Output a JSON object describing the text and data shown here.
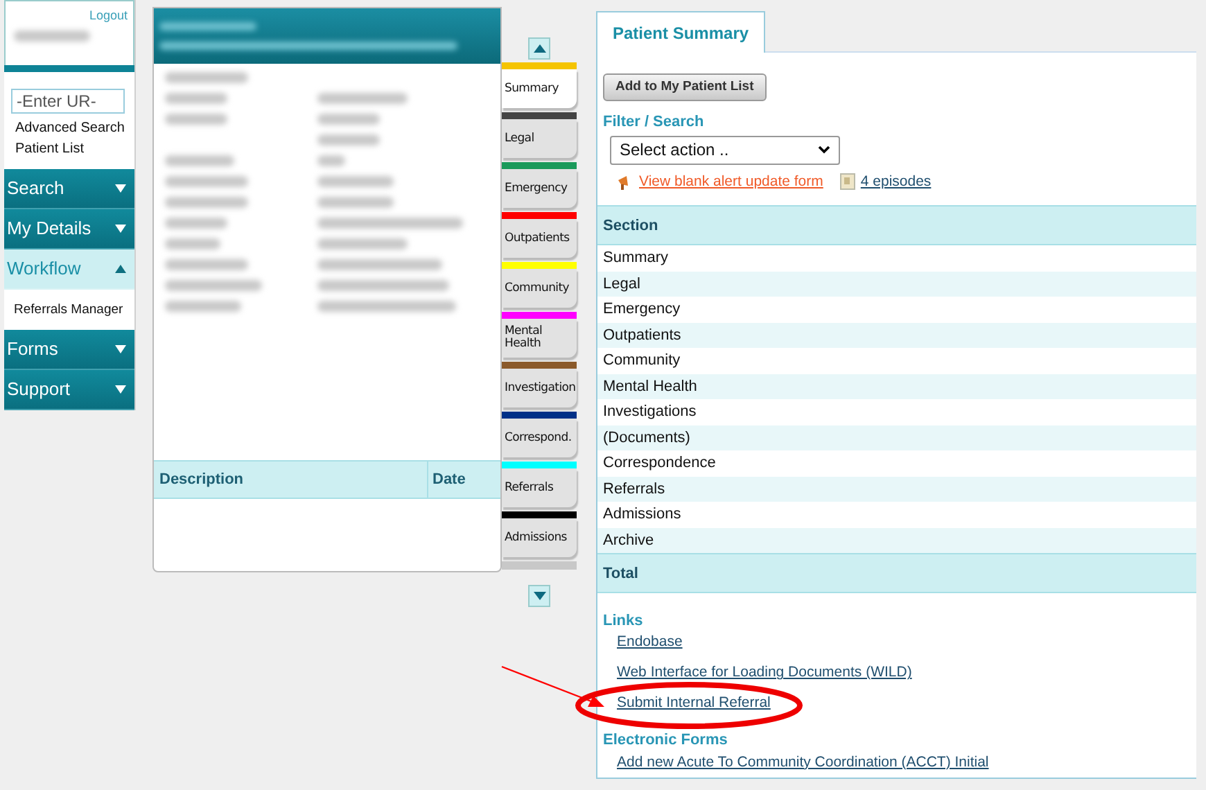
{
  "header": {
    "logout": "Logout"
  },
  "ur_search": {
    "placeholder": "-Enter UR-"
  },
  "quick_links": [
    "Advanced Search",
    "Patient List"
  ],
  "menu": [
    {
      "label": "Search",
      "expanded": false
    },
    {
      "label": "My Details",
      "expanded": false
    },
    {
      "label": "Workflow",
      "expanded": true,
      "children": [
        "Referrals Manager"
      ]
    },
    {
      "label": "Forms",
      "expanded": false
    },
    {
      "label": "Support",
      "expanded": false
    }
  ],
  "details_table": {
    "columns": [
      "Description",
      "Date"
    ]
  },
  "side_tabs": [
    {
      "label": "Summary",
      "color": "#f5c400",
      "selected": true
    },
    {
      "label": "Legal",
      "color": "#444444",
      "selected": false
    },
    {
      "label": "Emergency",
      "color": "#1a9a5a",
      "selected": false
    },
    {
      "label": "Outpatients",
      "color": "#ff0000",
      "selected": false
    },
    {
      "label": "Community",
      "color": "#ffff00",
      "selected": false
    },
    {
      "label": "Mental Health",
      "color": "#ff00ff",
      "selected": false
    },
    {
      "label": "Investigation",
      "color": "#8b5a2b",
      "selected": false
    },
    {
      "label": "Correspond.",
      "color": "#003087",
      "selected": false
    },
    {
      "label": "Referrals",
      "color": "#00ffff",
      "selected": false
    },
    {
      "label": "Admissions",
      "color": "#000000",
      "selected": false
    }
  ],
  "summary": {
    "tab": "Patient Summary",
    "add_button": "Add to My Patient List",
    "filter_label": "Filter / Search",
    "select_value": "Select action ..",
    "alert_link": "View blank alert update form",
    "episodes_link": "4 episodes",
    "section_header": "Section",
    "sections": [
      "Summary",
      "Legal",
      "Emergency",
      "Outpatients",
      "Community",
      "Mental Health",
      "Investigations",
      "(Documents)",
      "Correspondence",
      "Referrals",
      "Admissions",
      "Archive"
    ],
    "total": "Total",
    "links_heading": "Links",
    "links": [
      "Endobase",
      "Web Interface for Loading Documents (WILD)",
      "Submit Internal Referral"
    ],
    "forms_heading": "Electronic Forms",
    "forms": [
      "Add new Acute To Community Coordination (ACCT) Initial"
    ]
  }
}
